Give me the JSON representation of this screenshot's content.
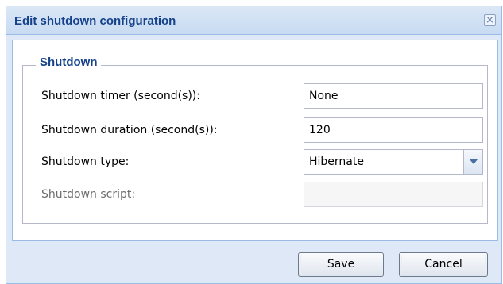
{
  "dialog": {
    "title": "Edit shutdown configuration",
    "close_icon": "close-icon",
    "fieldset_legend": "Shutdown",
    "fields": {
      "timer": {
        "label": "Shutdown timer (second(s)):",
        "value": "None"
      },
      "duration": {
        "label": "Shutdown duration (second(s)):",
        "value": "120"
      },
      "type": {
        "label": "Shutdown type:",
        "value": "Hibernate"
      },
      "script": {
        "label": "Shutdown script:",
        "value": "",
        "disabled": true
      }
    },
    "buttons": {
      "save": "Save",
      "cancel": "Cancel"
    }
  }
}
